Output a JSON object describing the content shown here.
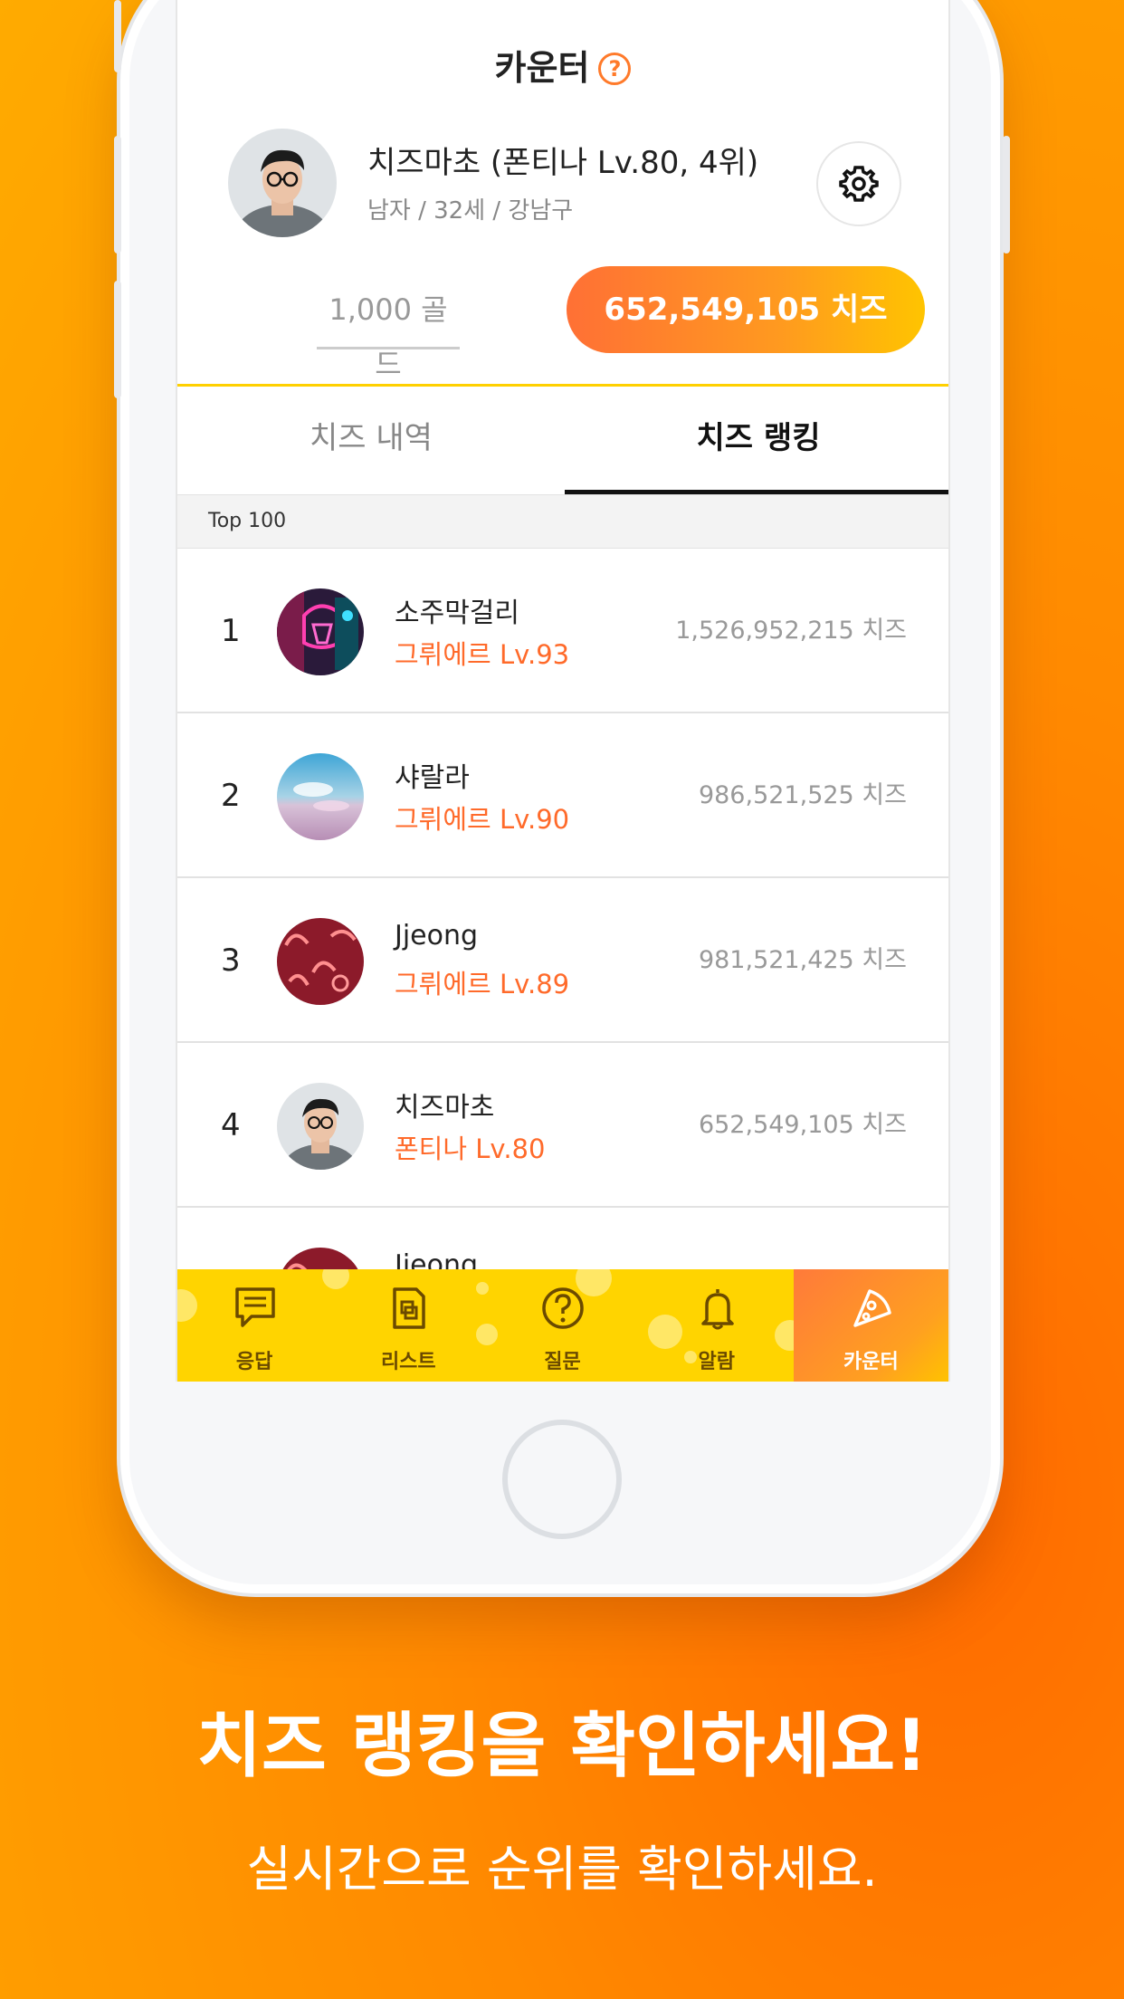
{
  "header": {
    "title": "카운터"
  },
  "profile": {
    "name": "치즈마초 (폰티나 Lv.80, 4위)",
    "info": "남자 / 32세 / 강남구"
  },
  "balance": {
    "gold": "1,000 골드",
    "cheese": "652,549,105 치즈"
  },
  "tabs": {
    "history": "치즈 내역",
    "ranking": "치즈 랭킹"
  },
  "ranking_header": "Top 100",
  "ranking": [
    {
      "rank": "1",
      "name": "소주막걸리",
      "level": "그뤼에르 Lv.93",
      "score": "1,526,952,215 치즈"
    },
    {
      "rank": "2",
      "name": "샤랄라",
      "level": "그뤼에르 Lv.90",
      "score": "986,521,525 치즈"
    },
    {
      "rank": "3",
      "name": "Jjeong",
      "level": "그뤼에르 Lv.89",
      "score": "981,521,425 치즈"
    },
    {
      "rank": "4",
      "name": "치즈마초",
      "level": "폰티나 Lv.80",
      "score": "652,549,105 치즈"
    },
    {
      "rank": "",
      "name": "Jjeong",
      "level": "",
      "score": ""
    }
  ],
  "nav": [
    {
      "label": "응답",
      "icon": "chat-icon"
    },
    {
      "label": "리스트",
      "icon": "list-icon"
    },
    {
      "label": "질문",
      "icon": "question-icon"
    },
    {
      "label": "알람",
      "icon": "bell-icon"
    },
    {
      "label": "카운터",
      "icon": "pizza-icon"
    }
  ],
  "captions": {
    "headline": "치즈 랭킹을 확인하세요!",
    "subline": "실시간으로 순위를 확인하세요."
  },
  "colors": {
    "accent": "#ff6a2a",
    "nav": "#ffd400",
    "underline": "#ffd000"
  }
}
